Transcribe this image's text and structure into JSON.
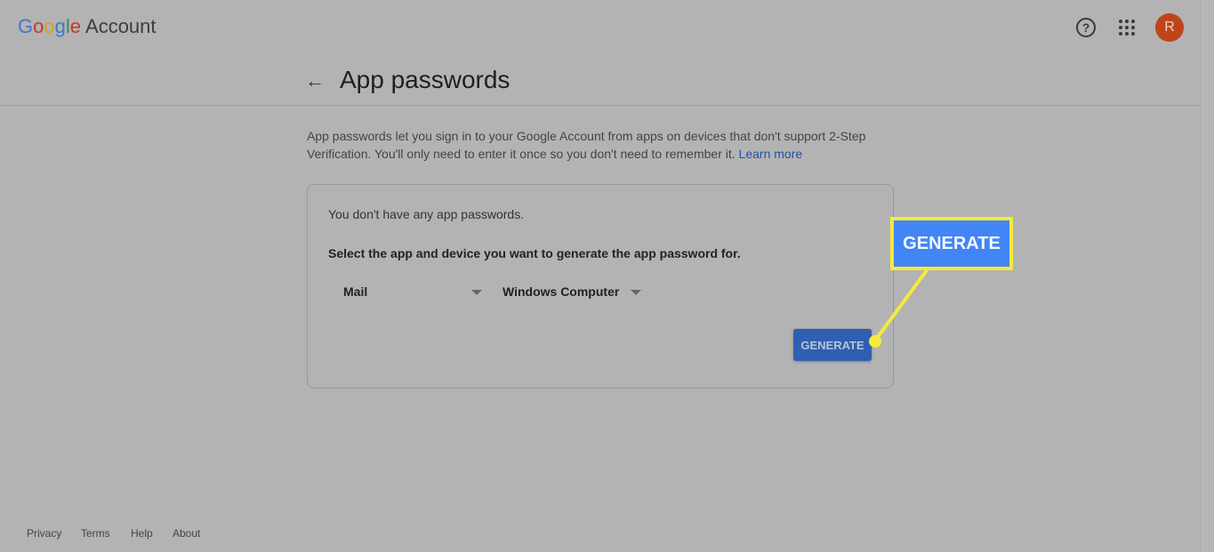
{
  "header": {
    "logo_google": "Google",
    "logo_account": "Account",
    "help_icon": "help-circle-icon",
    "apps_icon": "apps-grid-icon",
    "avatar_letter": "R",
    "avatar_color": "#c0441a"
  },
  "page": {
    "title": "App passwords",
    "back_icon": "arrow-left-icon",
    "description": "App passwords let you sign in to your Google Account from apps on devices that don't support 2-Step Verification. You'll only need to enter it once so you don't need to remember it.",
    "learn_more": "Learn more"
  },
  "card": {
    "empty_text": "You don't have any app passwords.",
    "instruction": "Select the app and device you want to generate the app password for.",
    "app_select": "Mail",
    "device_select": "Windows Computer",
    "generate_label": "GENERATE"
  },
  "callout": {
    "label": "GENERATE",
    "color": "#f7e93b"
  },
  "footer": {
    "links": [
      "Privacy",
      "Terms",
      "Help",
      "About"
    ]
  }
}
